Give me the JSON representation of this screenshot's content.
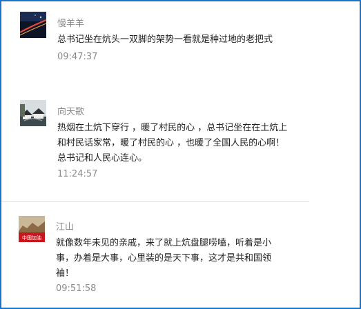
{
  "comments": [
    {
      "user": "慢羊羊",
      "avatar": "night-road-avatar",
      "lines": [
        "总书记坐在炕头一双脚的架势一看就是种过地的老把式"
      ],
      "time": "09:47:37"
    },
    {
      "user": "向天歌",
      "avatar": "water-town-avatar",
      "lines": [
        "热烟在土炕下穿行 ，暖了村民的心 ，总书记坐在在土炕上",
        "和村民话家常，暖了村民的心 ，也暖了全国人民的心啊！",
        "总书记和人民心连心。"
      ],
      "time": "11:24:57"
    },
    {
      "user": "江山",
      "avatar": "china-flag-avatar",
      "avatar_caption": "中国加油",
      "lines": [
        "就像数年未见的亲戚，来了就上炕盘腿唠嗑，听着是小",
        "事，办着是大事，心里装的是天下事，这才是共和国领",
        "袖！"
      ],
      "time": "09:51:58"
    }
  ],
  "colors": {
    "border": "#1a73c8",
    "meta_text": "#8a8a8a",
    "body_text": "#222222",
    "divider": "#e3e3e3"
  }
}
